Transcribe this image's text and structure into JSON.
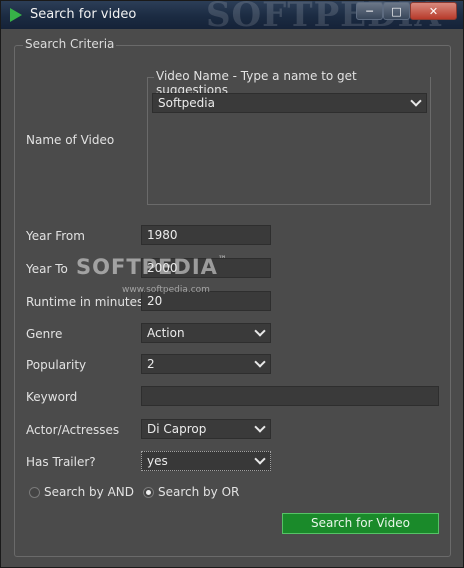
{
  "window": {
    "title": "Search for video",
    "watermark": "SOFTPEDIA"
  },
  "controls": {
    "minimize": "─",
    "maximize": "□",
    "close": "✕"
  },
  "form": {
    "group_title": "Search Criteria",
    "name_label": "Name of Video",
    "video_name_group": "Video Name - Type a name to get suggestions",
    "video_name_value": "Softpedia",
    "year_from_label": "Year From",
    "year_from_value": "1980",
    "year_to_label": "Year To",
    "year_to_value": "2000",
    "runtime_label": "Runtime in minutes",
    "runtime_value": "20",
    "genre_label": "Genre",
    "genre_value": "Action",
    "popularity_label": "Popularity",
    "popularity_value": "2",
    "keyword_label": "Keyword",
    "keyword_value": "",
    "actor_label": "Actor/Actresses",
    "actor_value": "Di Caprop",
    "trailer_label": "Has Trailer?",
    "trailer_value": "yes",
    "radio_and_label": "Search by AND",
    "radio_or_label": "Search by OR",
    "search_button": "Search for Video"
  },
  "overlay": {
    "watermark_big": "SOFTPEDIA",
    "watermark_tm": "™",
    "watermark_small": "www.softpedia.com"
  },
  "colors": {
    "background": "#4b4b4b",
    "accent_button": "#1a8a2a",
    "title_bar": "#1b2b42"
  }
}
